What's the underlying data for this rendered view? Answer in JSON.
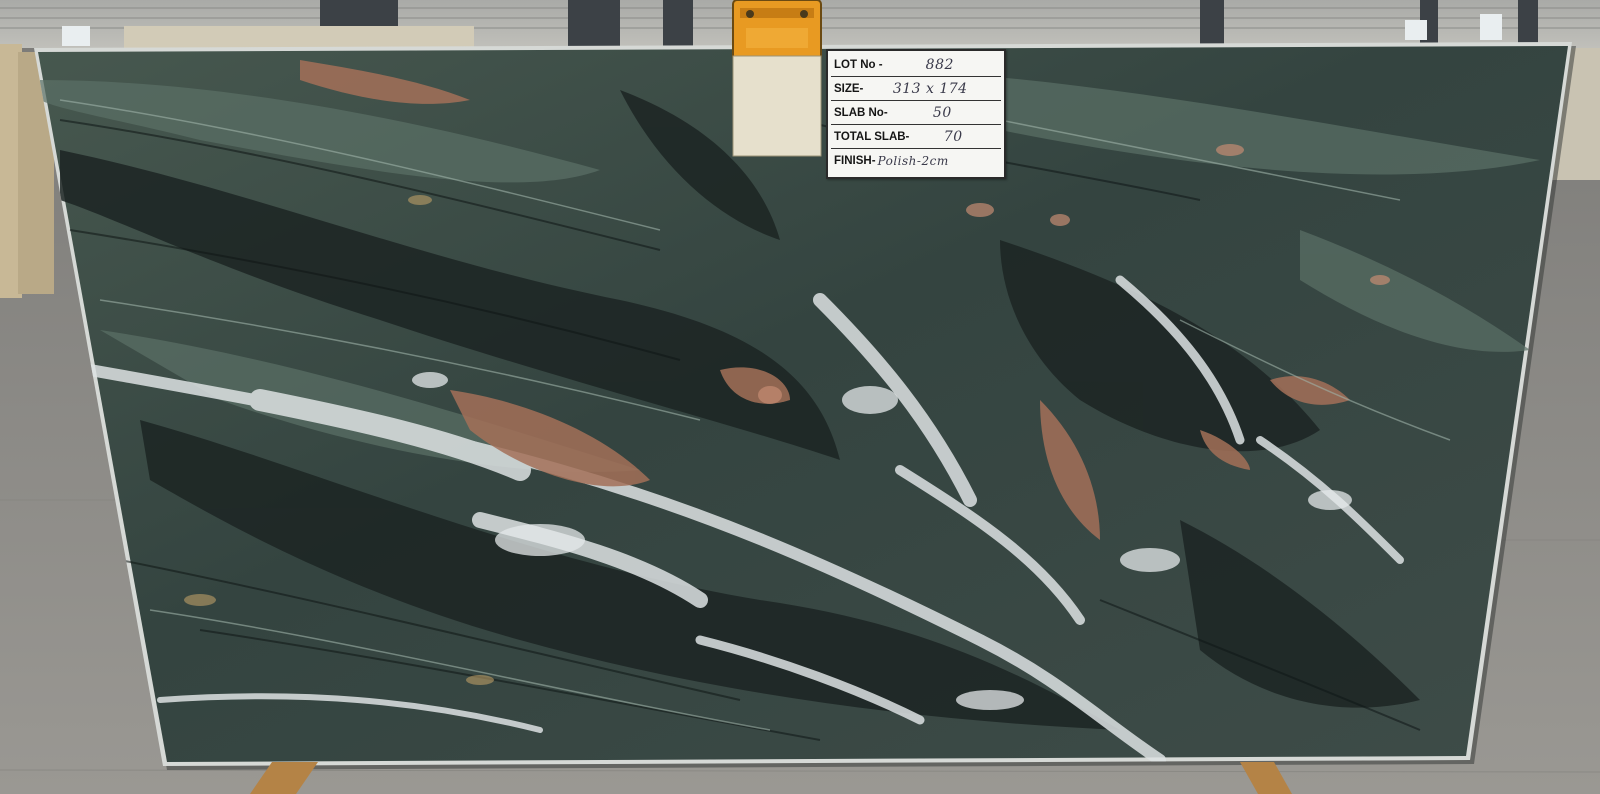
{
  "photo": {
    "subject": "Polished green marble slab",
    "palette": {
      "floor": "#8f8d89",
      "slab_base": "#3c4a46",
      "slab_dark": "#1f2a28",
      "vein_white": "#dfe3e4",
      "vein_rust": "#a06e55",
      "clamp_orange": "#e89a22",
      "wall": "#b5b5b0"
    }
  },
  "lot_label": {
    "rows": [
      {
        "key": "LOT No -",
        "value": "882"
      },
      {
        "key": "SIZE-",
        "value": "313 x 174"
      },
      {
        "key": "SLAB No-",
        "value": "50"
      },
      {
        "key": "TOTAL SLAB-",
        "value": "70"
      },
      {
        "key": "FINISH-",
        "value": "Polish-2cm"
      }
    ]
  }
}
